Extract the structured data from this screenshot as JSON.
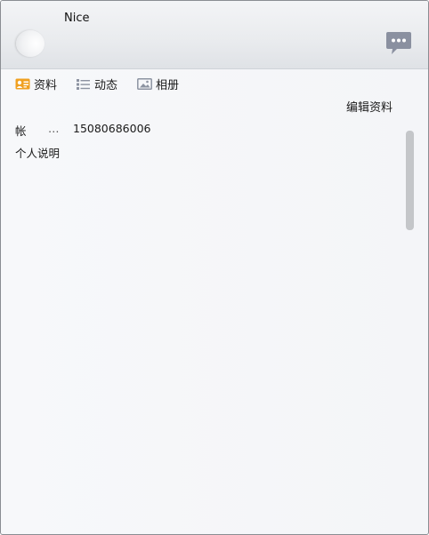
{
  "header": {
    "nickname": "Nice"
  },
  "tabs": [
    {
      "label": "资料",
      "icon": "profile-card-icon"
    },
    {
      "label": "动态",
      "icon": "feed-list-icon"
    },
    {
      "label": "相册",
      "icon": "photo-album-icon"
    }
  ],
  "edit_profile_label": "编辑资料",
  "profile": {
    "account_label": "帐",
    "account_ellipsis": "…",
    "account_value": "15080686006",
    "signature_label": "个人说明"
  },
  "colors": {
    "profile_icon_accent": "#f0a020",
    "icon_gray": "#8c93a1",
    "chat_icon": "#8a90a0"
  }
}
